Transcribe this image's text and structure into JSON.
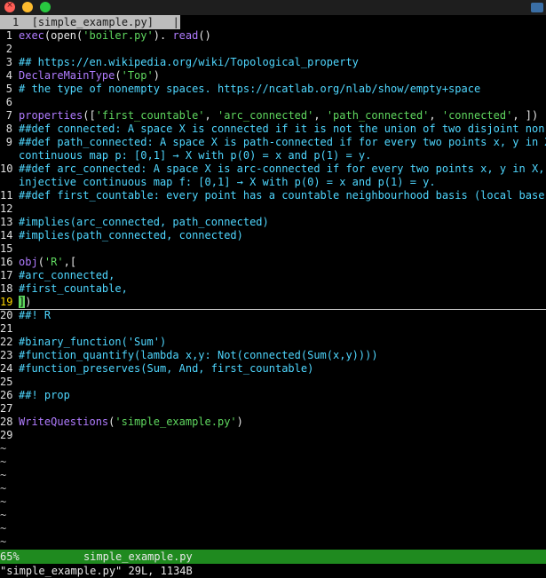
{
  "tab": {
    "number": "1",
    "label": "[simple_example.py]",
    "sep": "|"
  },
  "editor_lines": [
    {
      "n": "1",
      "segs": [
        [
          "fn",
          "exec"
        ],
        [
          "",
          "(open("
        ],
        [
          "str",
          "'boiler.py'"
        ],
        [
          "",
          "). "
        ],
        [
          "fn",
          "read"
        ],
        [
          "",
          "()"
        ]
      ]
    },
    {
      "n": "2",
      "segs": []
    },
    {
      "n": "3",
      "segs": [
        [
          "cm",
          "## https://en.wikipedia.org/wiki/Topological_property"
        ]
      ]
    },
    {
      "n": "4",
      "segs": [
        [
          "fn",
          "DeclareMainType"
        ],
        [
          "",
          "("
        ],
        [
          "str",
          "'Top'"
        ],
        [
          "",
          ")"
        ]
      ]
    },
    {
      "n": "5",
      "segs": [
        [
          "cm",
          "# the type of nonempty spaces. https://ncatlab.org/nlab/show/empty+space"
        ]
      ]
    },
    {
      "n": "6",
      "segs": []
    },
    {
      "n": "7",
      "segs": [
        [
          "fn",
          "properties"
        ],
        [
          "",
          "(["
        ],
        [
          "str",
          "'first_countable'"
        ],
        [
          "",
          ", "
        ],
        [
          "str",
          "'arc_connected'"
        ],
        [
          "",
          ", "
        ],
        [
          "str",
          "'path_connected'"
        ],
        [
          "",
          ", "
        ],
        [
          "str",
          "'connected'"
        ],
        [
          "",
          ", ])"
        ]
      ]
    },
    {
      "n": "8",
      "segs": [
        [
          "cm",
          "##def connected: A space X is connected if it is not the union of two disjoint non-em"
        ]
      ]
    },
    {
      "n": "9",
      "segs": [
        [
          "cm",
          "##def path_connected: A space X is path-connected if for every two points x, y in X,"
        ]
      ]
    },
    {
      "n": "",
      "segs": [
        [
          "cm",
          "continuous map p: [0,1] → X with p(0) = x and p(1) = y."
        ]
      ]
    },
    {
      "n": "10",
      "segs": [
        [
          "cm",
          "##def arc_connected: A space X is arc-connected if for every two points x, y in X, th"
        ]
      ]
    },
    {
      "n": "",
      "segs": [
        [
          "cm",
          "injective continuous map f: [0,1] → X with p(0) = x and p(1) = y."
        ]
      ]
    },
    {
      "n": "11",
      "segs": [
        [
          "cm",
          "##def first_countable: every point has a countable neighbourhood basis (local base)"
        ]
      ]
    },
    {
      "n": "12",
      "segs": []
    },
    {
      "n": "13",
      "segs": [
        [
          "cm",
          "#implies(arc_connected, path_connected)"
        ]
      ]
    },
    {
      "n": "14",
      "segs": [
        [
          "cm",
          "#implies(path_connected, connected)"
        ]
      ]
    },
    {
      "n": "15",
      "segs": []
    },
    {
      "n": "16",
      "segs": [
        [
          "fn",
          "obj"
        ],
        [
          "",
          "("
        ],
        [
          "str",
          "'R'"
        ],
        [
          "",
          ",["
        ]
      ]
    },
    {
      "n": "17",
      "segs": [
        [
          "cm",
          "#arc_connected,"
        ]
      ]
    },
    {
      "n": "18",
      "segs": [
        [
          "cm",
          "#first_countable,"
        ]
      ]
    },
    {
      "n": "19",
      "cur": true,
      "segs": [
        [
          "cursor",
          "]"
        ],
        [
          "",
          ")"
        ]
      ]
    },
    {
      "n": "20",
      "segs": [
        [
          "cm",
          "##! R"
        ]
      ]
    },
    {
      "n": "21",
      "segs": []
    },
    {
      "n": "22",
      "segs": [
        [
          "cm",
          "#binary_function('Sum')"
        ]
      ]
    },
    {
      "n": "23",
      "segs": [
        [
          "cm",
          "#function_quantify(lambda x,y: Not(connected(Sum(x,y))))"
        ]
      ]
    },
    {
      "n": "24",
      "segs": [
        [
          "cm",
          "#function_preserves(Sum, And, first_countable)"
        ]
      ]
    },
    {
      "n": "25",
      "segs": []
    },
    {
      "n": "26",
      "segs": [
        [
          "cm",
          "##! prop"
        ]
      ]
    },
    {
      "n": "27",
      "segs": []
    },
    {
      "n": "28",
      "segs": [
        [
          "fn",
          "WriteQuestions"
        ],
        [
          "",
          "("
        ],
        [
          "str",
          "'simple_example.py'"
        ],
        [
          "",
          ")"
        ]
      ]
    },
    {
      "n": "29",
      "segs": []
    },
    {
      "n": "~",
      "tilde": true,
      "segs": []
    },
    {
      "n": "~",
      "tilde": true,
      "segs": []
    },
    {
      "n": "~",
      "tilde": true,
      "segs": []
    },
    {
      "n": "~",
      "tilde": true,
      "segs": []
    },
    {
      "n": "~",
      "tilde": true,
      "segs": []
    },
    {
      "n": "~",
      "tilde": true,
      "segs": []
    },
    {
      "n": "~",
      "tilde": true,
      "segs": []
    },
    {
      "n": "~",
      "tilde": true,
      "segs": []
    }
  ],
  "status": {
    "percent": "65%",
    "filename": "simple_example.py"
  },
  "cmdline": "\"simple_example.py\" 29L, 1134B",
  "colors": {
    "comment": "#4fd7ff",
    "string": "#5fd75f",
    "function": "#b07cff",
    "status_bg": "#1f8a1f"
  }
}
